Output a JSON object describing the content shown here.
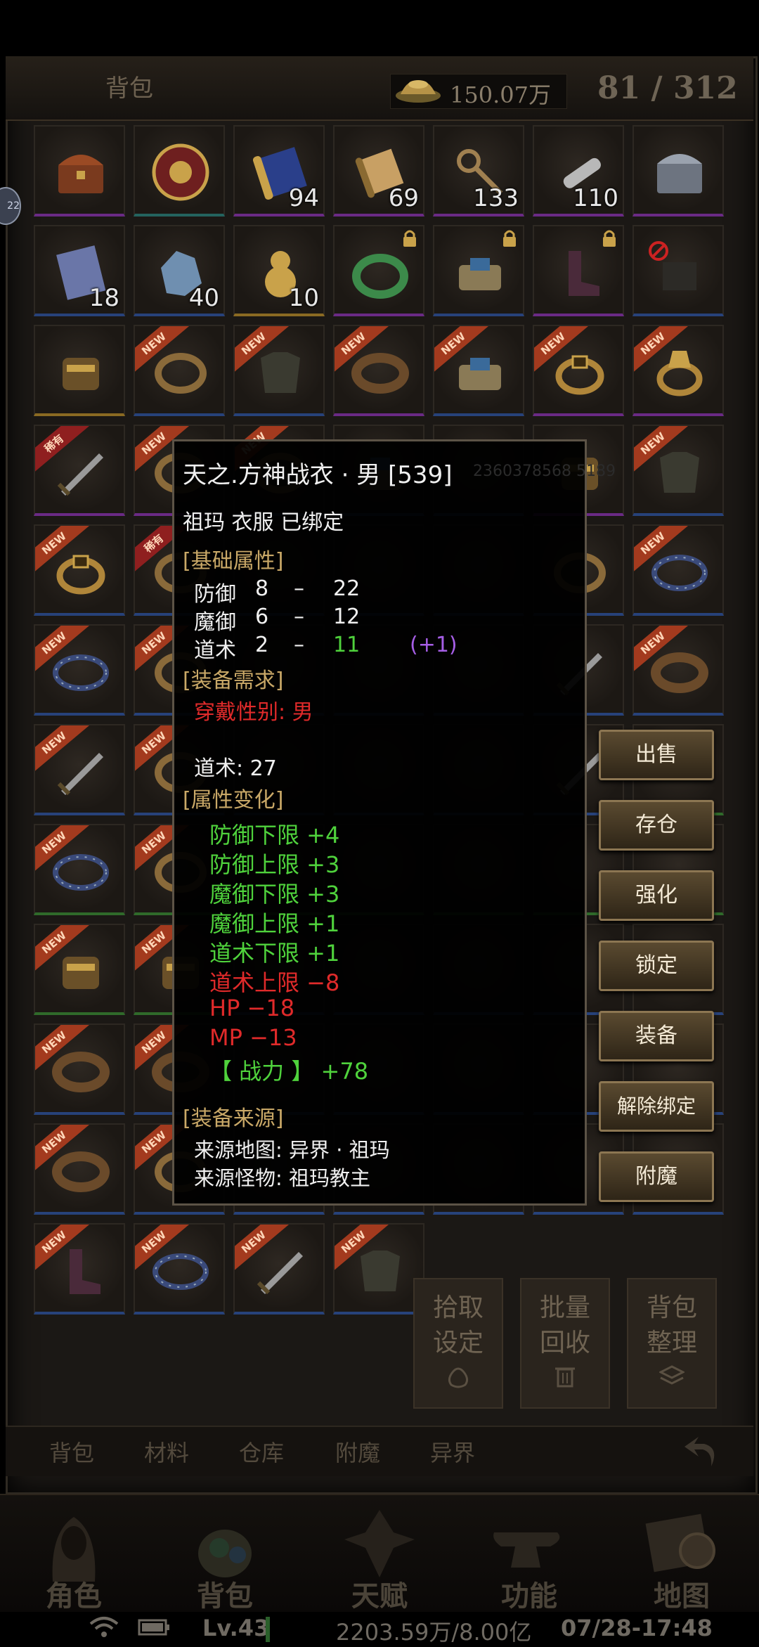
{
  "header": {
    "title": "背包",
    "gold": "150.07万",
    "capacity": "81 / 312"
  },
  "side_bubble": "22",
  "grid": {
    "rows": [
      [
        {
          "icon": "chest-icon",
          "q": "purple"
        },
        {
          "icon": "medallion-icon",
          "q": "teal"
        },
        {
          "icon": "scroll-map-icon",
          "q": "purple",
          "count": "94"
        },
        {
          "icon": "scroll-icon",
          "q": "purple",
          "count": "69"
        },
        {
          "icon": "key-icon",
          "q": "purple",
          "count": "133"
        },
        {
          "icon": "whistle-icon",
          "q": "purple",
          "count": "110"
        },
        {
          "icon": "silver-chest-icon",
          "q": "purple"
        }
      ],
      [
        {
          "icon": "cloth-icon",
          "q": "blue",
          "count": "18"
        },
        {
          "icon": "ore-icon",
          "q": "blue",
          "count": "40"
        },
        {
          "icon": "gourd-icon",
          "q": "gold",
          "count": "10"
        },
        {
          "icon": "jade-ring-icon",
          "q": "purple",
          "lock": true
        },
        {
          "icon": "bundle-icon",
          "q": "blue",
          "lock": true
        },
        {
          "icon": "boots-icon",
          "q": "purple",
          "lock": true
        },
        {
          "icon": "forbidden-item-icon",
          "q": "blue"
        }
      ],
      [
        {
          "icon": "gauntlet-icon",
          "q": "gold"
        },
        {
          "icon": "ring-icon",
          "q": "blue",
          "ribbon": "NEW"
        },
        {
          "icon": "armor-icon",
          "q": "blue",
          "ribbon": "NEW"
        },
        {
          "icon": "bracelet-icon",
          "q": "purple",
          "ribbon": "NEW"
        },
        {
          "icon": "bundle-icon",
          "q": "blue",
          "ribbon": "NEW"
        },
        {
          "icon": "gold-ring-icon",
          "q": "purple",
          "ribbon": "NEW"
        },
        {
          "icon": "dragon-ring-icon",
          "q": "purple",
          "ribbon": "NEW"
        }
      ],
      [
        {
          "icon": "sword-icon",
          "q": "purple",
          "ribbon": "稀有",
          "ribbon_red": true
        },
        {
          "icon": "ring-icon",
          "q": "purple",
          "ribbon": "NEW"
        },
        {
          "icon": "ring-icon",
          "q": "blue",
          "ribbon": "NEW"
        },
        {
          "icon": "bundle-icon",
          "q": "blue"
        },
        {
          "icon": "empty",
          "q": "blue"
        },
        {
          "icon": "gauntlet-icon",
          "q": "purple"
        },
        {
          "icon": "armor-icon",
          "q": "blue",
          "ribbon": "NEW"
        }
      ],
      [
        {
          "icon": "gold-ring-icon",
          "q": "blue",
          "ribbon": "NEW"
        },
        {
          "icon": "ring-icon",
          "q": "blue",
          "ribbon": "稀有",
          "ribbon_red": true
        },
        {
          "icon": "empty",
          "q": "blue"
        },
        {
          "icon": "empty",
          "q": "blue"
        },
        {
          "icon": "empty",
          "q": "blue"
        },
        {
          "icon": "ring-icon",
          "q": "blue"
        },
        {
          "icon": "spiked-bracelet-icon",
          "q": "blue",
          "ribbon": "NEW"
        }
      ],
      [
        {
          "icon": "spiked-bracelet-icon",
          "q": "blue",
          "ribbon": "NEW"
        },
        {
          "icon": "ring-icon",
          "q": "blue",
          "ribbon": "NEW"
        },
        {
          "icon": "empty",
          "q": "blue"
        },
        {
          "icon": "empty",
          "q": "blue"
        },
        {
          "icon": "empty",
          "q": "blue"
        },
        {
          "icon": "sword-icon",
          "q": "blue"
        },
        {
          "icon": "bracelet-icon",
          "q": "blue",
          "ribbon": "NEW"
        }
      ],
      [
        {
          "icon": "sword-icon",
          "q": "blue",
          "ribbon": "NEW"
        },
        {
          "icon": "ring-icon",
          "q": "blue",
          "ribbon": "NEW"
        },
        {
          "icon": "empty",
          "q": "blue"
        },
        {
          "icon": "empty",
          "q": "blue"
        },
        {
          "icon": "empty",
          "q": "blue"
        },
        {
          "icon": "sword-icon",
          "q": "blue"
        },
        {
          "icon": "empty",
          "q": "green"
        }
      ],
      [
        {
          "icon": "spiked-bracelet-icon",
          "q": "green",
          "ribbon": "NEW"
        },
        {
          "icon": "ring-icon",
          "q": "green",
          "ribbon": "NEW"
        },
        {
          "icon": "empty",
          "q": "green"
        },
        {
          "icon": "empty",
          "q": "green"
        },
        {
          "icon": "empty",
          "q": "green"
        },
        {
          "icon": "empty",
          "q": "green"
        },
        {
          "icon": "empty",
          "q": "green"
        }
      ],
      [
        {
          "icon": "gauntlet-icon",
          "q": "green",
          "ribbon": "NEW"
        },
        {
          "icon": "gauntlet-icon",
          "q": "green",
          "ribbon": "NEW"
        },
        {
          "icon": "empty",
          "q": "blue"
        },
        {
          "icon": "empty",
          "q": "blue"
        },
        {
          "icon": "empty",
          "q": "blue"
        },
        {
          "icon": "empty",
          "q": "blue"
        },
        {
          "icon": "empty",
          "q": "blue"
        }
      ],
      [
        {
          "icon": "bracelet-icon",
          "q": "blue",
          "ribbon": "NEW"
        },
        {
          "icon": "bracelet-icon",
          "q": "blue",
          "ribbon": "NEW"
        },
        {
          "icon": "empty",
          "q": "blue"
        },
        {
          "icon": "empty",
          "q": "blue"
        },
        {
          "icon": "empty",
          "q": "blue"
        },
        {
          "icon": "empty",
          "q": "blue"
        },
        {
          "icon": "empty",
          "q": "blue"
        }
      ],
      [
        {
          "icon": "bracelet-icon",
          "q": "blue",
          "ribbon": "NEW"
        },
        {
          "icon": "ring-icon",
          "q": "blue",
          "ribbon": "NEW"
        },
        {
          "icon": "empty",
          "q": "blue"
        },
        {
          "icon": "empty",
          "q": "blue"
        },
        {
          "icon": "empty",
          "q": "blue"
        },
        {
          "icon": "empty",
          "q": "blue"
        },
        {
          "icon": "empty",
          "q": "blue"
        }
      ],
      [
        {
          "icon": "boots-icon",
          "q": "blue",
          "ribbon": "NEW"
        },
        {
          "icon": "spiked-bracelet-icon",
          "q": "blue",
          "ribbon": "NEW"
        },
        {
          "icon": "sword-icon",
          "q": "blue",
          "ribbon": "NEW"
        },
        {
          "icon": "armor-icon",
          "q": "blue",
          "ribbon": "NEW"
        }
      ]
    ]
  },
  "tooltip": {
    "name": "天之.方神战衣 · 男 [539]",
    "ghost_id": "2360378568 5189",
    "subtitle": "祖玛 衣服 已绑定",
    "basic_header": "[基础属性]",
    "stats": [
      {
        "label": "防御",
        "min": "8",
        "dash": "–",
        "max": "22",
        "bonus": ""
      },
      {
        "label": "魔御",
        "min": "6",
        "dash": "–",
        "max": "12",
        "bonus": ""
      },
      {
        "label": "道术",
        "min": "2",
        "dash": "–",
        "max": "11",
        "bonus": "(+1)"
      }
    ],
    "req_header": "[装备需求]",
    "req_gender": "穿戴性别: 男",
    "req_skill": "道术: 27",
    "change_header": "[属性变化]",
    "changes": [
      {
        "text": "防御下限  +4",
        "c": "green"
      },
      {
        "text": "防御上限  +3",
        "c": "green"
      },
      {
        "text": "魔御下限  +3",
        "c": "green"
      },
      {
        "text": "魔御上限  +1",
        "c": "green"
      },
      {
        "text": "道术下限  +1",
        "c": "green"
      },
      {
        "text": "道术上限  −8",
        "c": "red"
      },
      {
        "text": "HP  −18",
        "c": "red"
      },
      {
        "text": "MP  −13",
        "c": "red"
      },
      {
        "text": "【 战力 】 +78",
        "c": "green"
      }
    ],
    "source_header": "[装备来源]",
    "source_map": "来源地图:   异界 · 祖玛",
    "source_monster": "来源怪物:   祖玛教主"
  },
  "actions": [
    "出售",
    "存仓",
    "强化",
    "锁定",
    "装备",
    "解除绑定",
    "附魔"
  ],
  "utility": [
    {
      "line1": "拾取",
      "line2": "设定",
      "icon": "bag-icon"
    },
    {
      "line1": "批量",
      "line2": "回收",
      "icon": "trash-icon"
    },
    {
      "line1": "背包",
      "line2": "整理",
      "icon": "layers-icon"
    }
  ],
  "subtabs": [
    "背包",
    "材料",
    "仓库",
    "附魔",
    "异界"
  ],
  "nav": [
    "角色",
    "背包",
    "天赋",
    "功能",
    "地图"
  ],
  "status": {
    "level": "Lv.43",
    "resources": "2203.59万/8.00亿",
    "datetime": "07/28-17:48"
  },
  "colors": {
    "gold_text": "#c9a867",
    "good": "#4fd23c",
    "bad": "#e02a2a",
    "bonus": "#a65ee6",
    "button_border": "#8c7652"
  }
}
